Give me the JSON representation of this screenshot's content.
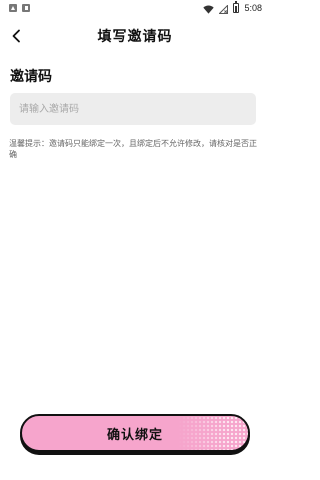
{
  "status_bar": {
    "time": "5:08",
    "icons": [
      "notification-icon",
      "notification-icon",
      "wifi-icon",
      "no-signal-icon",
      "battery-icon"
    ]
  },
  "header": {
    "title": "填写邀请码",
    "back_icon": "chevron-left-icon"
  },
  "invite": {
    "label": "邀请码",
    "value": "",
    "placeholder": "请输入邀请码",
    "hint": "温馨提示：邀请码只能绑定一次，且绑定后不允许修改，请核对是否正确"
  },
  "confirm_button": {
    "label": "确认绑定",
    "color": "#f6a5cc"
  }
}
